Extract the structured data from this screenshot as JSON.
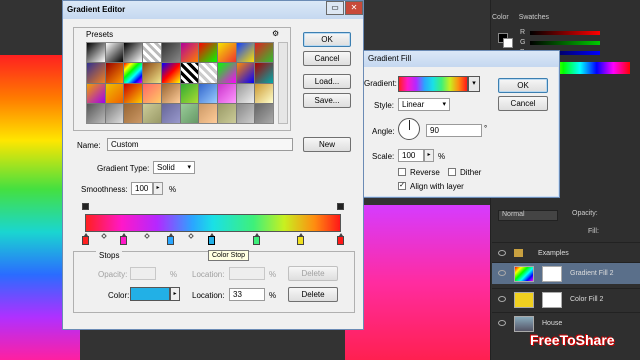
{
  "gradient_editor": {
    "title": "Gradient Editor",
    "presets_label": "Presets",
    "buttons": {
      "ok": "OK",
      "cancel": "Cancel",
      "load": "Load...",
      "save": "Save...",
      "new": "New"
    },
    "name_label": "Name:",
    "name_value": "Custom",
    "gradient_type_label": "Gradient Type:",
    "gradient_type_value": "Solid",
    "smoothness_label": "Smoothness:",
    "smoothness_value": "100",
    "percent": "%",
    "stops_label": "Stops",
    "opacity_label": "Opacity:",
    "location_label": "Location:",
    "delete_label": "Delete",
    "color_label": "Color:",
    "color_location_value": "33",
    "tooltip": "Color Stop"
  },
  "gradient_fill": {
    "title": "Gradient Fill",
    "gradient_label": "Gradient:",
    "style_label": "Style:",
    "style_value": "Linear",
    "angle_label": "Angle:",
    "angle_value": "90",
    "degree": "°",
    "scale_label": "Scale:",
    "scale_value": "100",
    "percent": "%",
    "reverse_label": "Reverse",
    "dither_label": "Dither",
    "align_label": "Align with layer",
    "ok": "OK",
    "cancel": "Cancel"
  },
  "right_panel": {
    "tabs": [
      "Color",
      "Swatches"
    ],
    "slider_letters": [
      "R",
      "G",
      "B"
    ],
    "blend_mode": "Normal",
    "opacity_label": "Opacity:",
    "fill_label": "Fill:",
    "layers": [
      "Examples",
      "Gradient Fill 2",
      "Color Fill 2",
      "House"
    ]
  },
  "watermark": "FreeToShare",
  "colors": {
    "selected_stop": "#22b0e6",
    "accent": "#3c7fb1"
  }
}
